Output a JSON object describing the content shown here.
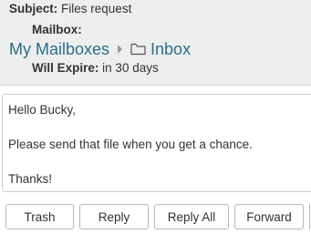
{
  "header": {
    "subject_label": "Subject:",
    "subject_value": "Files request",
    "mailbox_label": "Mailbox:",
    "breadcrumb": {
      "root_label": "My Mailboxes",
      "folder_label": "Inbox"
    },
    "expire_label": "Will Expire:",
    "expire_value": "in 30 days"
  },
  "message": {
    "greeting": "Hello Bucky,",
    "body": "Please send that file when you get a chance.",
    "closing": "Thanks!"
  },
  "actions": {
    "trash_label": "Trash",
    "reply_label": "Reply",
    "reply_all_label": "Reply All",
    "forward_label": "Forward"
  },
  "colors": {
    "link": "#2a6e8c",
    "header_bg": "#eeeeee"
  }
}
